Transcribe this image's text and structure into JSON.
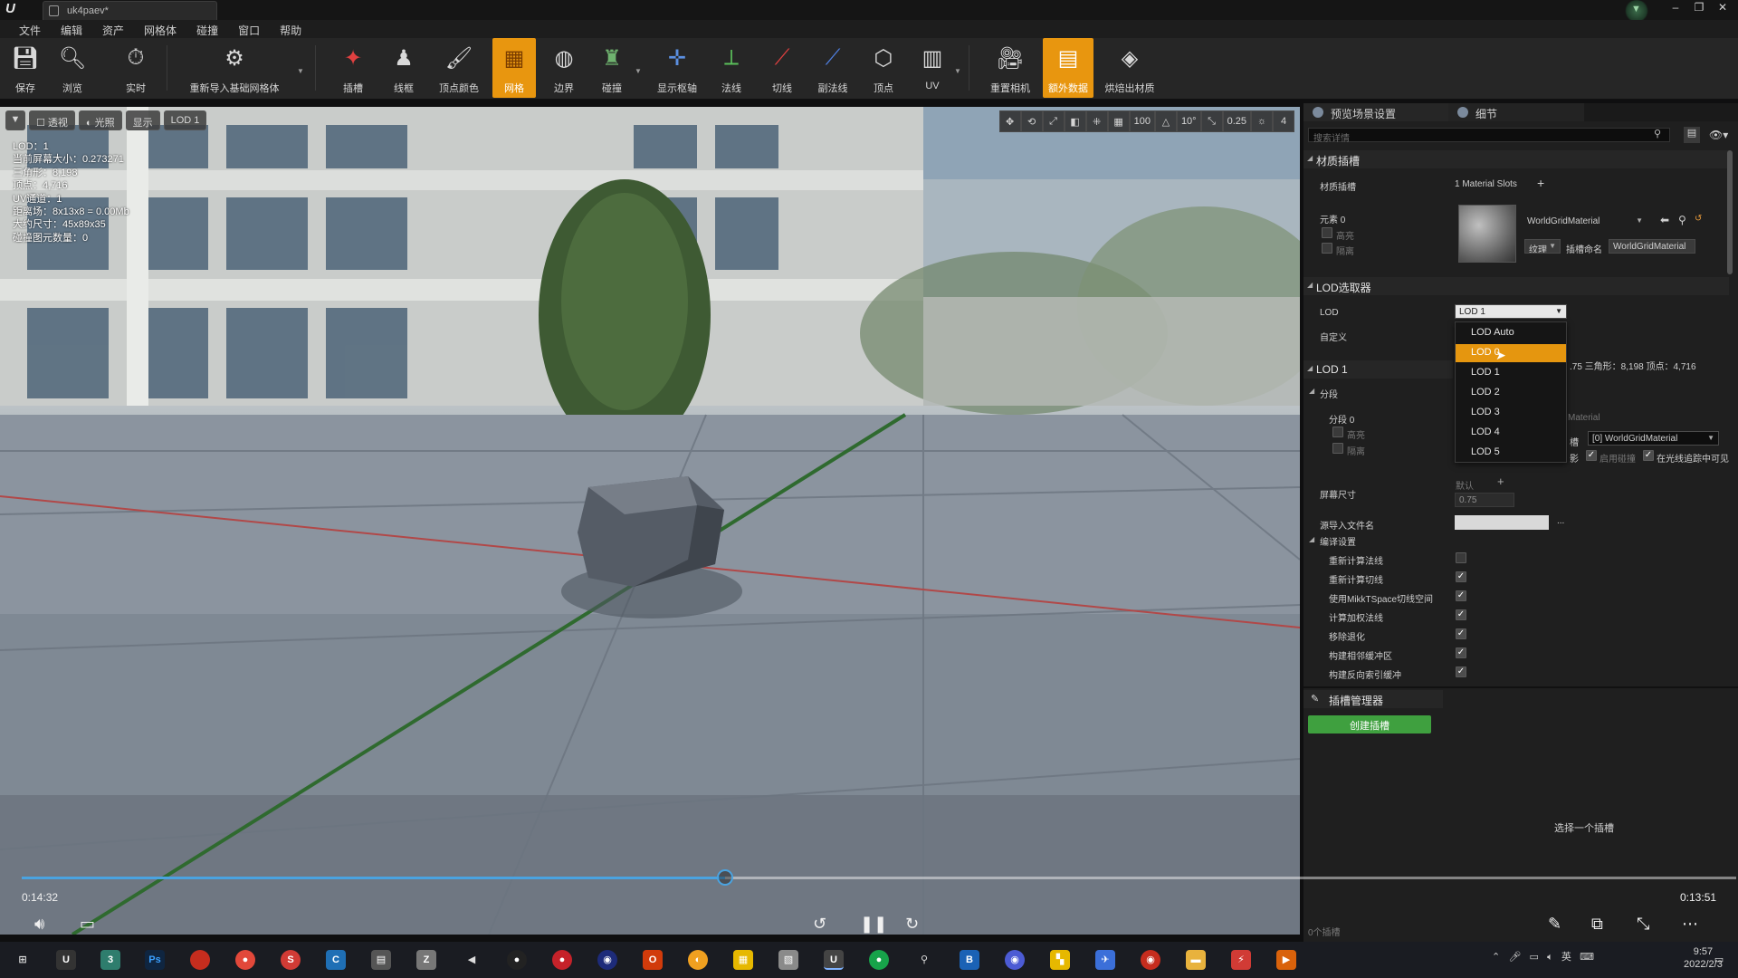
{
  "window": {
    "tab_title": "uk4paev*",
    "controls": [
      "–",
      "❐",
      "✕"
    ]
  },
  "menu": [
    "文件",
    "编辑",
    "资产",
    "网格体",
    "碰撞",
    "窗口",
    "帮助"
  ],
  "toolbar": {
    "items": [
      {
        "label": "保存",
        "icon": "save-icon"
      },
      {
        "label": "浏览",
        "icon": "browse-icon"
      },
      {
        "label": "实时",
        "icon": "realtime-icon"
      },
      {
        "label": "重新导入基础网格体",
        "icon": "reimport-icon"
      },
      {
        "label": "插槽",
        "icon": "socket-icon"
      },
      {
        "label": "线框",
        "icon": "wireframe-icon"
      },
      {
        "label": "顶点颜色",
        "icon": "vertex-color-icon"
      },
      {
        "label": "网格",
        "icon": "grid-icon"
      },
      {
        "label": "边界",
        "icon": "bounds-icon"
      },
      {
        "label": "碰撞",
        "icon": "collision-icon"
      },
      {
        "label": "显示枢轴",
        "icon": "pivot-icon"
      },
      {
        "label": "法线",
        "icon": "normals-icon"
      },
      {
        "label": "切线",
        "icon": "tangents-icon"
      },
      {
        "label": "副法线",
        "icon": "binormals-icon"
      },
      {
        "label": "顶点",
        "icon": "vertices-icon"
      },
      {
        "label": "UV",
        "icon": "uv-icon"
      },
      {
        "label": "重置相机",
        "icon": "reset-camera-icon"
      },
      {
        "label": "额外数据",
        "icon": "additional-data-icon"
      },
      {
        "label": "烘焙出材质",
        "icon": "bake-material-icon"
      }
    ],
    "active": [
      "网格",
      "额外数据"
    ]
  },
  "viewport": {
    "buttons": {
      "perspective": "透视",
      "lit": "光照",
      "show": "显示",
      "lod": "LOD 1"
    },
    "right_controls": [
      "✥",
      "⟲",
      "⤢",
      "◧",
      "⁜",
      "▦",
      "100",
      "△",
      "10°",
      "⤡",
      "0.25",
      "☼",
      "4"
    ],
    "stats": [
      "LOD：1",
      "当前屏幕大小：0.273271",
      "三角形：8,198",
      "顶点：4,716",
      "UV通道：1",
      "距离场：8x13x8 = 0.00Mb",
      "大约尺寸：45x89x35",
      "碰撞图元数量：0"
    ]
  },
  "video": {
    "current_time": "0:14:32",
    "remaining_time": "0:13:51",
    "progress": 0.41
  },
  "right_panel": {
    "tabs": [
      "预览场景设置",
      "细节"
    ],
    "search_placeholder": "搜索详情",
    "material_section": {
      "title": "材质插槽",
      "row_label": "材质插槽",
      "slots_text": "1 Material Slots",
      "element_label": "元素 0",
      "highlight": "高亮",
      "isolate": "隔离",
      "material_name": "WorldGridMaterial",
      "texture_button": "纹理",
      "slot_name_label": "插槽命名",
      "slot_name_value": "WorldGridMaterial"
    },
    "lod_picker": {
      "title": "LOD选取器",
      "lod_label": "LOD",
      "lod_value": "LOD 1",
      "custom_label": "自定义",
      "options": [
        "LOD Auto",
        "LOD 0",
        "LOD 1",
        "LOD 2",
        "LOD 3",
        "LOD 4",
        "LOD 5"
      ],
      "hovered": "LOD 0",
      "info_text": ".75   三角形：8,198   顶点：4,716"
    },
    "lod1_section": {
      "title": "LOD 1",
      "sections_label": "分段",
      "section0_label": "分段 0",
      "highlight": "高亮",
      "isolate": "隔离",
      "material_hint": "Material",
      "slot_label": "槽",
      "slot_value": "[0] WorldGridMaterial",
      "shadow_label": "影",
      "collision_label": "启用碰撞",
      "raytracing_label": "在光线追踪中可见",
      "screen_size_label": "屏幕尺寸",
      "screen_default": "默认",
      "screen_value": "0.75",
      "source_file_label": "源导入文件名",
      "source_file_more": "..."
    },
    "build_settings": {
      "title": "编译设置",
      "items": [
        {
          "label": "重新计算法线",
          "checked": false
        },
        {
          "label": "重新计算切线",
          "checked": true
        },
        {
          "label": "使用MikkTSpace切线空间",
          "checked": true
        },
        {
          "label": "计算加权法线",
          "checked": true
        },
        {
          "label": "移除退化",
          "checked": true
        },
        {
          "label": "构建相邻缓冲区",
          "checked": true
        },
        {
          "label": "构建反向索引缓冲",
          "checked": true
        }
      ]
    },
    "socket_manager": {
      "title": "插槽管理器",
      "create_button": "创建插槽",
      "hint": "选择一个插槽",
      "count": "0个插槽"
    }
  },
  "taskbar": {
    "tray_lang": "英",
    "time": "9:57",
    "date": "2022/2/3"
  },
  "colors": {
    "accent": "#e8960f",
    "create_button": "#3fa03f",
    "progress": "#4aa3e0"
  }
}
